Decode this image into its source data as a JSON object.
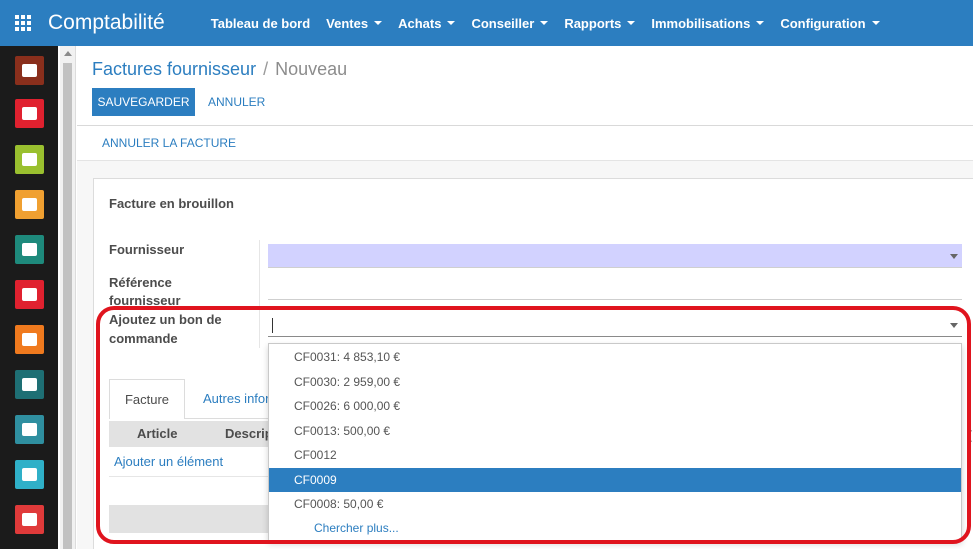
{
  "app": {
    "title": "Comptabilité",
    "menu": [
      "Tableau de bord",
      "Ventes",
      "Achats",
      "Conseiller",
      "Rapports",
      "Immobilisations",
      "Configuration"
    ]
  },
  "sidebar_apps": [
    {
      "name": "discuss-app-icon",
      "color": "#8a2f1c"
    },
    {
      "name": "mail-app-icon",
      "color": "#e0212f"
    },
    {
      "name": "calendar-app-icon",
      "color": "#9ac02f"
    },
    {
      "name": "maps-app-icon",
      "color": "#f0a031"
    },
    {
      "name": "contacts-app-icon",
      "color": "#1e8a7c"
    },
    {
      "name": "documents-app-icon",
      "color": "#e0212f"
    },
    {
      "name": "reporting-app-icon",
      "color": "#f07a1e"
    },
    {
      "name": "website-app-icon",
      "color": "#1e6f74"
    },
    {
      "name": "pos-app-icon",
      "color": "#2f8fa0"
    },
    {
      "name": "payments-app-icon",
      "color": "#2fb0c8"
    },
    {
      "name": "building-app-icon",
      "color": "#e03a3a"
    }
  ],
  "breadcrumb": {
    "parent": "Factures fournisseur",
    "separator": "/",
    "current": "Nouveau"
  },
  "buttons": {
    "save": "SAUVEGARDER",
    "cancel": "ANNULER",
    "cancel_invoice": "ANNULER LA FACTURE"
  },
  "form": {
    "status": "Facture en brouillon",
    "labels": {
      "supplier": "Fournisseur",
      "supplier_ref_line1": "Référence",
      "supplier_ref_line2": "fournisseur",
      "po_line1": "Ajoutez un bon de",
      "po_line2": "commande"
    },
    "values": {
      "supplier": "",
      "supplier_ref": "",
      "po": ""
    }
  },
  "notebook": {
    "tabs": [
      "Facture",
      "Autres infor"
    ],
    "columns": [
      "Article",
      "Descrip"
    ],
    "add_line": "Ajouter un élément"
  },
  "dropdown": {
    "items": [
      "CF0031: 4 853,10 €",
      "CF0030: 2 959,00 €",
      "CF0026: 6 000,00 €",
      "CF0013: 500,00 €",
      "CF0012",
      "CF0009",
      "CF0008: 50,00 €"
    ],
    "selected_index": 5,
    "more": "Chercher plus..."
  },
  "colors": {
    "brand": "#2c7ec0",
    "highlight": "#e0141e",
    "supplier_field": "#d2d2ff"
  }
}
